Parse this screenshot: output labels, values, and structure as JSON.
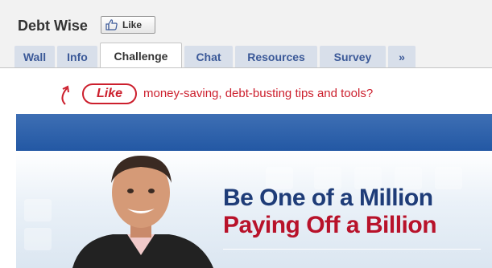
{
  "page": {
    "title": "Debt Wise",
    "like_button": {
      "label": "Like",
      "icon": "thumbs-up-icon"
    }
  },
  "tabs": [
    {
      "label": "Wall",
      "active": false
    },
    {
      "label": "Info",
      "active": false
    },
    {
      "label": "Challenge",
      "active": true
    },
    {
      "label": "Chat",
      "active": false
    },
    {
      "label": "Resources",
      "active": false
    },
    {
      "label": "Survey",
      "active": false
    },
    {
      "label": "»",
      "active": false
    }
  ],
  "banner": {
    "like_label": "Like",
    "text": "money-saving, debt-busting tips and tools?",
    "icon": "curved-arrow-icon"
  },
  "hero": {
    "line1": "Be One of a Million",
    "line2": "Paying Off a Billion"
  },
  "colors": {
    "accent_red": "#cc1f2d",
    "brand_blue": "#2358a4",
    "tab_bg": "#d8dfea",
    "tab_text": "#3b5998",
    "headline_navy": "#1e3c78",
    "headline_red": "#b8122a"
  }
}
